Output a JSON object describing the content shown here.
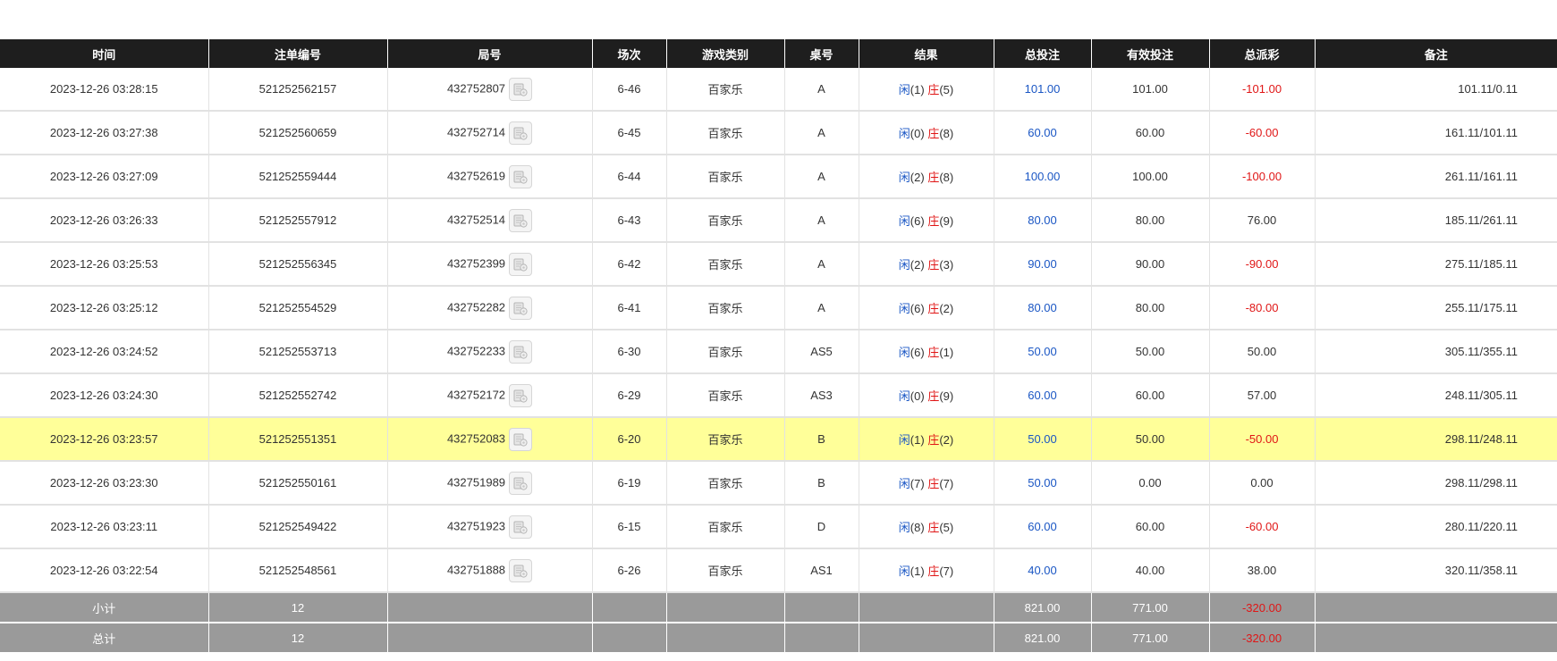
{
  "headers": [
    "时间",
    "注单编号",
    "局号",
    "场次",
    "游戏类别",
    "桌号",
    "结果",
    "总投注",
    "有效投注",
    "总派彩",
    "备注"
  ],
  "colors": {
    "header_bg": "#1e1e1e",
    "highlight": "#ffff99",
    "footer_bg": "#9a9a9a",
    "blue": "#1a56c4",
    "red": "#e01616"
  },
  "icon": "game-detail-icon",
  "rows": [
    {
      "time": "2023-12-26 03:28:15",
      "bet_id": "521252562157",
      "round": "432752807",
      "session": "6-46",
      "game": "百家乐",
      "table": "A",
      "xian_label": "闲",
      "xian_val": "(1)",
      "zhuang_label": "庄",
      "zhuang_val": "(5)",
      "total_bet": "101.00",
      "valid_bet": "101.00",
      "payout": "-101.00",
      "payout_color": "red",
      "remark": "101.11/0.11",
      "highlight": false
    },
    {
      "time": "2023-12-26 03:27:38",
      "bet_id": "521252560659",
      "round": "432752714",
      "session": "6-45",
      "game": "百家乐",
      "table": "A",
      "xian_label": "闲",
      "xian_val": "(0)",
      "zhuang_label": "庄",
      "zhuang_val": "(8)",
      "total_bet": "60.00",
      "valid_bet": "60.00",
      "payout": "-60.00",
      "payout_color": "red",
      "remark": "161.11/101.11",
      "highlight": false
    },
    {
      "time": "2023-12-26 03:27:09",
      "bet_id": "521252559444",
      "round": "432752619",
      "session": "6-44",
      "game": "百家乐",
      "table": "A",
      "xian_label": "闲",
      "xian_val": "(2)",
      "zhuang_label": "庄",
      "zhuang_val": "(8)",
      "total_bet": "100.00",
      "valid_bet": "100.00",
      "payout": "-100.00",
      "payout_color": "red",
      "remark": "261.11/161.11",
      "highlight": false
    },
    {
      "time": "2023-12-26 03:26:33",
      "bet_id": "521252557912",
      "round": "432752514",
      "session": "6-43",
      "game": "百家乐",
      "table": "A",
      "xian_label": "闲",
      "xian_val": "(6)",
      "zhuang_label": "庄",
      "zhuang_val": "(9)",
      "total_bet": "80.00",
      "valid_bet": "80.00",
      "payout": "76.00",
      "payout_color": "black",
      "remark": "185.11/261.11",
      "highlight": false
    },
    {
      "time": "2023-12-26 03:25:53",
      "bet_id": "521252556345",
      "round": "432752399",
      "session": "6-42",
      "game": "百家乐",
      "table": "A",
      "xian_label": "闲",
      "xian_val": "(2)",
      "zhuang_label": "庄",
      "zhuang_val": "(3)",
      "total_bet": "90.00",
      "valid_bet": "90.00",
      "payout": "-90.00",
      "payout_color": "red",
      "remark": "275.11/185.11",
      "highlight": false
    },
    {
      "time": "2023-12-26 03:25:12",
      "bet_id": "521252554529",
      "round": "432752282",
      "session": "6-41",
      "game": "百家乐",
      "table": "A",
      "xian_label": "闲",
      "xian_val": "(6)",
      "zhuang_label": "庄",
      "zhuang_val": "(2)",
      "total_bet": "80.00",
      "valid_bet": "80.00",
      "payout": "-80.00",
      "payout_color": "red",
      "remark": "255.11/175.11",
      "highlight": false
    },
    {
      "time": "2023-12-26 03:24:52",
      "bet_id": "521252553713",
      "round": "432752233",
      "session": "6-30",
      "game": "百家乐",
      "table": "AS5",
      "xian_label": "闲",
      "xian_val": "(6)",
      "zhuang_label": "庄",
      "zhuang_val": "(1)",
      "total_bet": "50.00",
      "valid_bet": "50.00",
      "payout": "50.00",
      "payout_color": "black",
      "remark": "305.11/355.11",
      "highlight": false
    },
    {
      "time": "2023-12-26 03:24:30",
      "bet_id": "521252552742",
      "round": "432752172",
      "session": "6-29",
      "game": "百家乐",
      "table": "AS3",
      "xian_label": "闲",
      "xian_val": "(0)",
      "zhuang_label": "庄",
      "zhuang_val": "(9)",
      "total_bet": "60.00",
      "valid_bet": "60.00",
      "payout": "57.00",
      "payout_color": "black",
      "remark": "248.11/305.11",
      "highlight": false
    },
    {
      "time": "2023-12-26 03:23:57",
      "bet_id": "521252551351",
      "round": "432752083",
      "session": "6-20",
      "game": "百家乐",
      "table": "B",
      "xian_label": "闲",
      "xian_val": "(1)",
      "zhuang_label": "庄",
      "zhuang_val": "(2)",
      "total_bet": "50.00",
      "valid_bet": "50.00",
      "payout": "-50.00",
      "payout_color": "red",
      "remark": "298.11/248.11",
      "highlight": true
    },
    {
      "time": "2023-12-26 03:23:30",
      "bet_id": "521252550161",
      "round": "432751989",
      "session": "6-19",
      "game": "百家乐",
      "table": "B",
      "xian_label": "闲",
      "xian_val": "(7)",
      "zhuang_label": "庄",
      "zhuang_val": "(7)",
      "total_bet": "50.00",
      "valid_bet": "0.00",
      "payout": "0.00",
      "payout_color": "black",
      "remark": "298.11/298.11",
      "highlight": false
    },
    {
      "time": "2023-12-26 03:23:11",
      "bet_id": "521252549422",
      "round": "432751923",
      "session": "6-15",
      "game": "百家乐",
      "table": "D",
      "xian_label": "闲",
      "xian_val": "(8)",
      "zhuang_label": "庄",
      "zhuang_val": "(5)",
      "total_bet": "60.00",
      "valid_bet": "60.00",
      "payout": "-60.00",
      "payout_color": "red",
      "remark": "280.11/220.11",
      "highlight": false
    },
    {
      "time": "2023-12-26 03:22:54",
      "bet_id": "521252548561",
      "round": "432751888",
      "session": "6-26",
      "game": "百家乐",
      "table": "AS1",
      "xian_label": "闲",
      "xian_val": "(1)",
      "zhuang_label": "庄",
      "zhuang_val": "(7)",
      "total_bet": "40.00",
      "valid_bet": "40.00",
      "payout": "38.00",
      "payout_color": "black",
      "remark": "320.11/358.11",
      "highlight": false
    }
  ],
  "footer": [
    {
      "label": "小计",
      "count": "12",
      "total_bet": "821.00",
      "valid_bet": "771.00",
      "payout": "-320.00"
    },
    {
      "label": "总计",
      "count": "12",
      "total_bet": "821.00",
      "valid_bet": "771.00",
      "payout": "-320.00"
    }
  ]
}
